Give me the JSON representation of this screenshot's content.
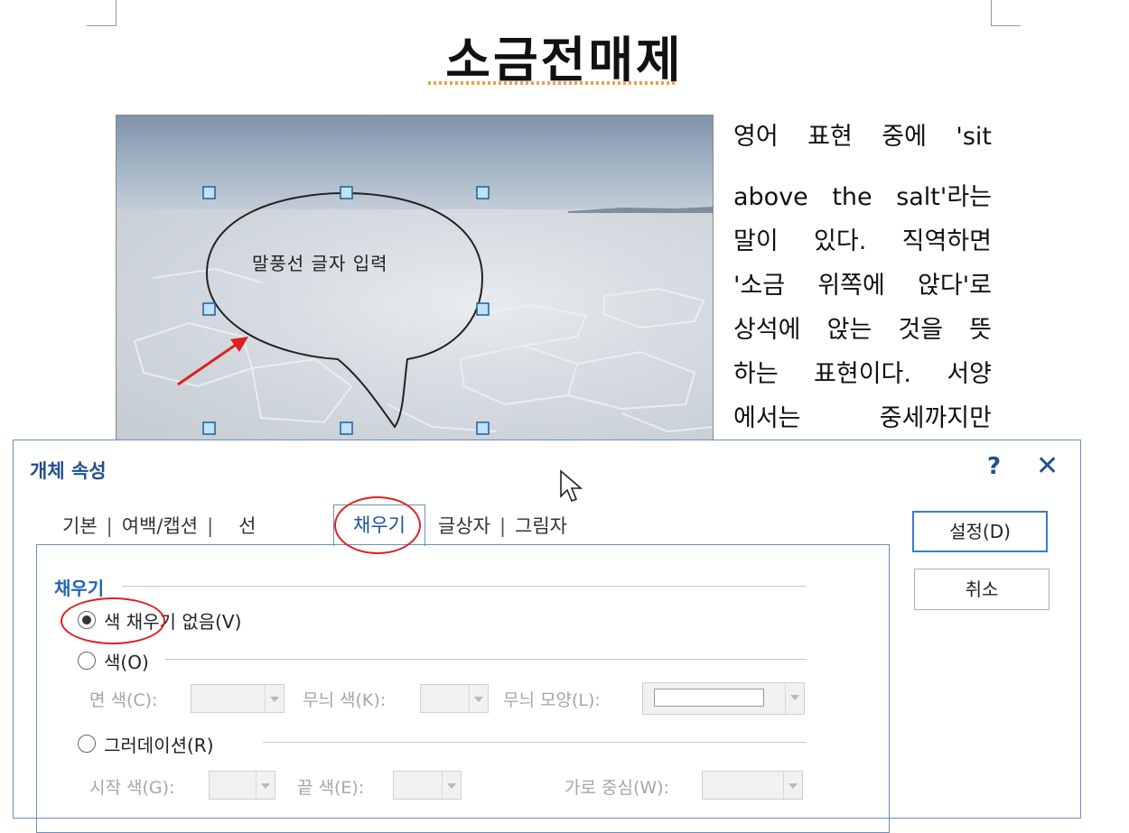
{
  "document": {
    "title": "소금전매제",
    "callout_text": "말풍선 글자 입력",
    "body_lines": [
      "영어 표현 중에 'sit",
      "above the salt'라는",
      "말이 있다. 직역하면",
      "'소금 위쪽에 앉다'로",
      "상석에 앉는 것을 뜻",
      "하는 표현이다. 서양",
      "에서는 중세까지만"
    ]
  },
  "dialog": {
    "title": "개체 속성",
    "help_glyph": "?",
    "close_glyph": "✕",
    "tabs": [
      "기본",
      "여백/캡션",
      "선",
      "채우기",
      "글상자",
      "그림자"
    ],
    "active_tab": "채우기",
    "section_label": "채우기",
    "options": {
      "no_fill": "색 채우기 없음(V)",
      "color": "색(O)",
      "gradation": "그러데이션(R)"
    },
    "color_fields": {
      "face_color": "면 색(C):",
      "pattern_color": "무늬 색(K):",
      "pattern_shape": "무늬 모양(L):"
    },
    "gradation_fields": {
      "start_color": "시작 색(G):",
      "end_color": "끝 색(E):",
      "horizontal_center": "가로 중심(W):"
    },
    "buttons": {
      "ok": "설정(D)",
      "cancel": "취소"
    }
  },
  "colors": {
    "accent": "#1f63b2",
    "annotation_red": "#e02020",
    "dialog_border": "#6c8fbc"
  }
}
